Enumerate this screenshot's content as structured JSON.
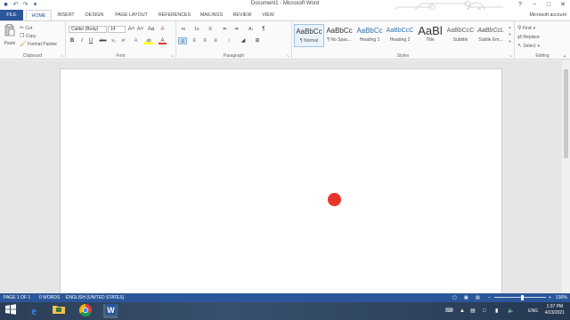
{
  "window": {
    "title": "Document1 - Microsoft Word",
    "help": "?",
    "controls": {
      "minimize": "−",
      "maximize": "□",
      "close": "✕"
    },
    "qat": {
      "save_icon": "■",
      "undo_icon": "↶",
      "redo_icon": "↷",
      "customize_icon": "▾"
    }
  },
  "tabs": [
    "FILE",
    "HOME",
    "INSERT",
    "DESIGN",
    "PAGE LAYOUT",
    "REFERENCES",
    "MAILINGS",
    "REVIEW",
    "VIEW"
  ],
  "account": "Microsoft account",
  "ribbon": {
    "clipboard": {
      "label": "Clipboard",
      "paste": "Paste",
      "cut": "Cut",
      "copy": "Copy",
      "format_painter": "Format Painter"
    },
    "font": {
      "label": "Font",
      "font_name": "Calibri (Body)",
      "font_size": "14",
      "grow": "A˄",
      "shrink": "A˅",
      "case": "Aa",
      "clear": "A",
      "bold": "B",
      "italic": "I",
      "underline": "U",
      "strike": "abc",
      "subscript": "x₂",
      "superscript": "x²",
      "effects": "A",
      "highlight": "ab",
      "font_color": "A"
    },
    "paragraph": {
      "label": "Paragraph",
      "bullets": "•≡",
      "numbering": "1≡",
      "multilevel": "≡",
      "decrease_indent": "⇤",
      "increase_indent": "⇥",
      "sort": "A↓",
      "show_marks": "¶",
      "align_left": "≡",
      "center": "≡",
      "align_right": "≡",
      "justify": "≡",
      "line_spacing": "↕",
      "shading": "◢",
      "borders": "⊞"
    },
    "styles": {
      "label": "Styles",
      "items": [
        {
          "sample": "AaBbCc",
          "name": "¶ Normal"
        },
        {
          "sample": "AaBbCc",
          "name": "¶ No Spac..."
        },
        {
          "sample": "AaBbCc",
          "name": "Heading 1"
        },
        {
          "sample": "AaBbCcC",
          "name": "Heading 2"
        },
        {
          "sample": "AaBl",
          "name": "Title"
        },
        {
          "sample": "AaBbCcC",
          "name": "Subtitle"
        },
        {
          "sample": "AaBbCcL",
          "name": "Subtle Em..."
        }
      ]
    },
    "editing": {
      "label": "Editing",
      "find": "Find",
      "replace": "Replace",
      "select": "Select"
    }
  },
  "status": {
    "page": "PAGE 1 OF 1",
    "words": "0 WORDS",
    "language": "ENGLISH (UNITED STATES)",
    "zoom": "130%",
    "zoom_fraction": 0.55
  },
  "taskbar": {
    "language": "ENG",
    "time": "1:37 PM",
    "date": "4/23/2021"
  },
  "colors": {
    "accent": "#2b579a",
    "red_dot": "#e6362b"
  }
}
